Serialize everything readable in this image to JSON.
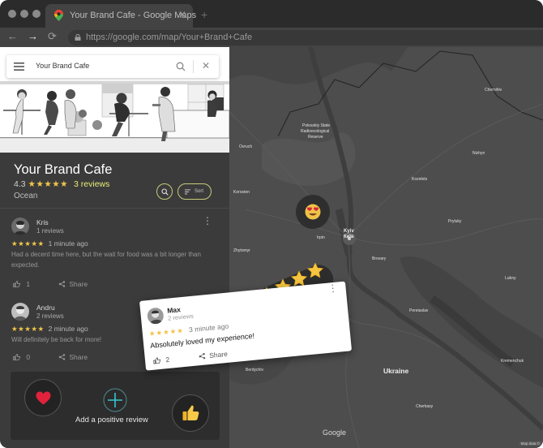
{
  "browser": {
    "tab_title": "Your Brand Cafe - Google Maps",
    "tab_close": "✕",
    "new_tab": "+",
    "back": "←",
    "forward": "→",
    "reload": "⟳",
    "url": "https://google.com/map/Your+Brand+Cafe"
  },
  "search": {
    "value": "Your Brand Cafe",
    "clear": "✕"
  },
  "place": {
    "name": "Your Brand Cafe",
    "rating": "4.3",
    "stars": "★★★★★",
    "reviews_link": "3 reviews",
    "category": "Ocean",
    "sort_label": "Sort"
  },
  "reviews": [
    {
      "name": "Kris",
      "count": "1 reviews",
      "stars": "★★★★★",
      "time": "1 minute ago",
      "text": "Had a decent time here, but the wait for food was a bit longer than expected.",
      "likes": "1",
      "share": "Share"
    },
    {
      "name": "Andru",
      "count": "2 reviews",
      "stars": "★★★★★",
      "time": "2 minute ago",
      "text": "Will definitely be back for more!",
      "likes": "0",
      "share": "Share"
    }
  ],
  "add_review": {
    "label": "Add a positive review",
    "plus": "+"
  },
  "floating_review": {
    "name": "Max",
    "count": "2 reviews",
    "stars": "★★★★★",
    "time": "3 minute ago",
    "text": "Absolutely loved my experience!",
    "likes": "2",
    "share": "Share"
  },
  "map": {
    "country_label": "Ukraine",
    "city_label": "Kyiv",
    "city_label_local": "Київ",
    "google_label": "Google",
    "data_label": "Map data ©"
  },
  "colors": {
    "accent": "#e7ee77",
    "star": "#f1c84a",
    "panel": "#3b3b3b",
    "map": "#4c4c4c"
  }
}
